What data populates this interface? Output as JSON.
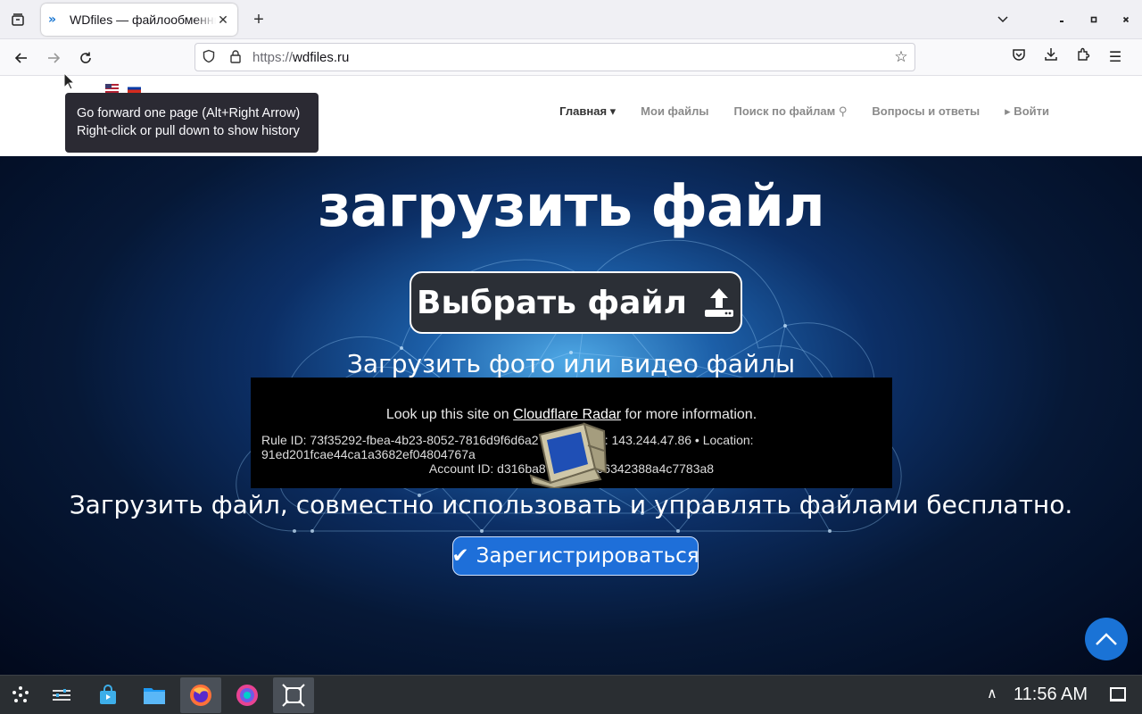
{
  "browser": {
    "tab_title": "WDfiles — файлообменник",
    "url_scheme": "https://",
    "url_host": "wdfiles.ru",
    "tooltip_line1": "Go forward one page (Alt+Right Arrow)",
    "tooltip_line2": "Right-click or pull down to show history"
  },
  "site": {
    "nav": [
      {
        "label": "Главная ▾"
      },
      {
        "label": "Мои файлы"
      },
      {
        "label": "Поиск по файлам ⚲"
      },
      {
        "label": "Вопросы и ответы"
      },
      {
        "label": "▸ Войти"
      }
    ],
    "hero_title": "загрузить файл",
    "choose_button": "Выбрать файл",
    "hero_sub": "Загрузить фото или видео файлы",
    "tagline": "Загрузить файл, совместно использовать и управлять файлами бесплатно.",
    "register_button": "Зарегистрироваться",
    "register_check": "✔"
  },
  "cloudflare": {
    "lookup_prefix": "Look up this site on ",
    "lookup_link": "Cloudflare Radar",
    "lookup_suffix": " for more information.",
    "rule_line": "Rule ID: 73f35292-fbea-4b23-8052-7816d9f6d6a2 • Source IP: 143.244.47.86 • Location: 91ed201fcae44ca1a3682ef04804767a",
    "account_line": "Account ID: d316ba87c100cf306342388a4c7783a8"
  },
  "taskbar": {
    "clock": "11:56 AM",
    "tray_arrow": "∧"
  },
  "colors": {
    "accent": "#1e6fd9",
    "hero_dark": "#061836",
    "taskbar": "#2a2e32"
  }
}
